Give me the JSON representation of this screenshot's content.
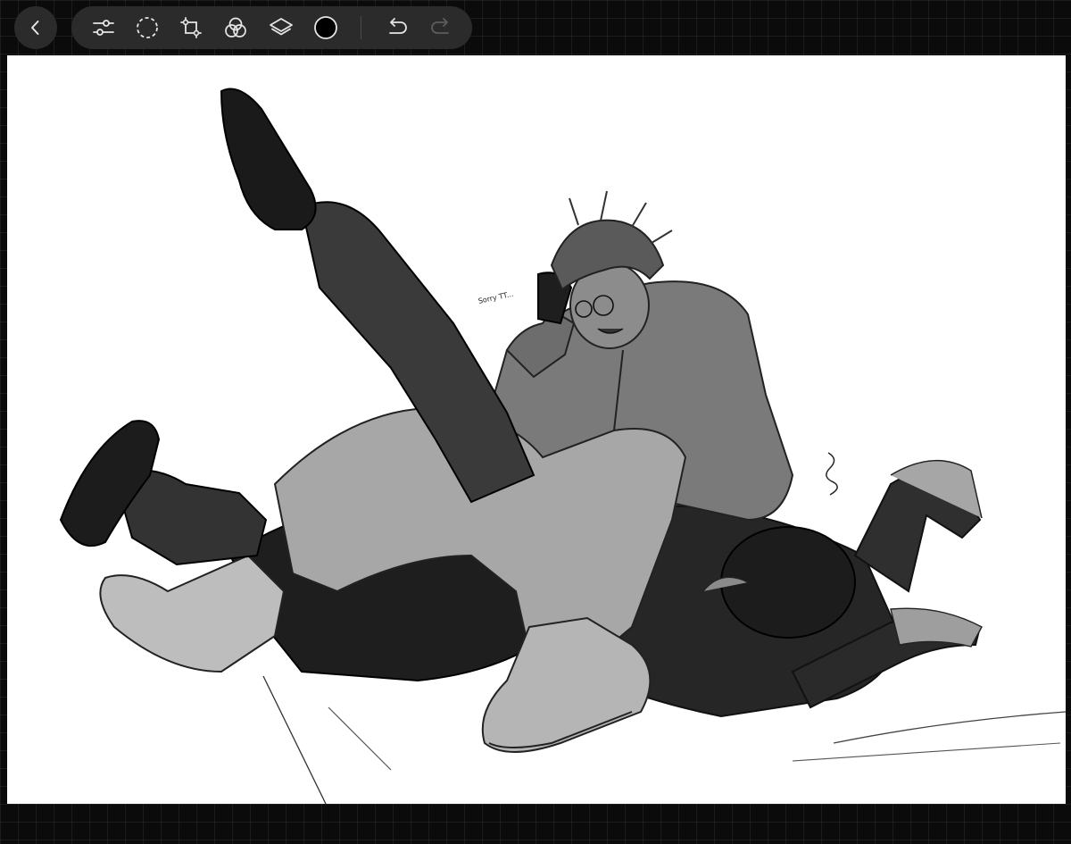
{
  "toolbar": {
    "back": "chevron-left-icon",
    "tools": [
      {
        "name": "adjustments-icon"
      },
      {
        "name": "selection-icon"
      },
      {
        "name": "transform-icon"
      },
      {
        "name": "color-mix-icon"
      },
      {
        "name": "layers-icon"
      },
      {
        "name": "color-swatch"
      }
    ],
    "history": [
      {
        "name": "undo-icon",
        "enabled": true
      },
      {
        "name": "redo-icon",
        "enabled": false
      }
    ],
    "current_color": "#000000"
  },
  "canvas": {
    "annotation_text": "Sorry TT..."
  },
  "colors": {
    "app_background": "#0b0b0b",
    "toolbar_background": "#2b2b2b",
    "icon": "#e6e6e6",
    "icon_disabled": "#5e5e5e",
    "canvas": "#ffffff"
  }
}
